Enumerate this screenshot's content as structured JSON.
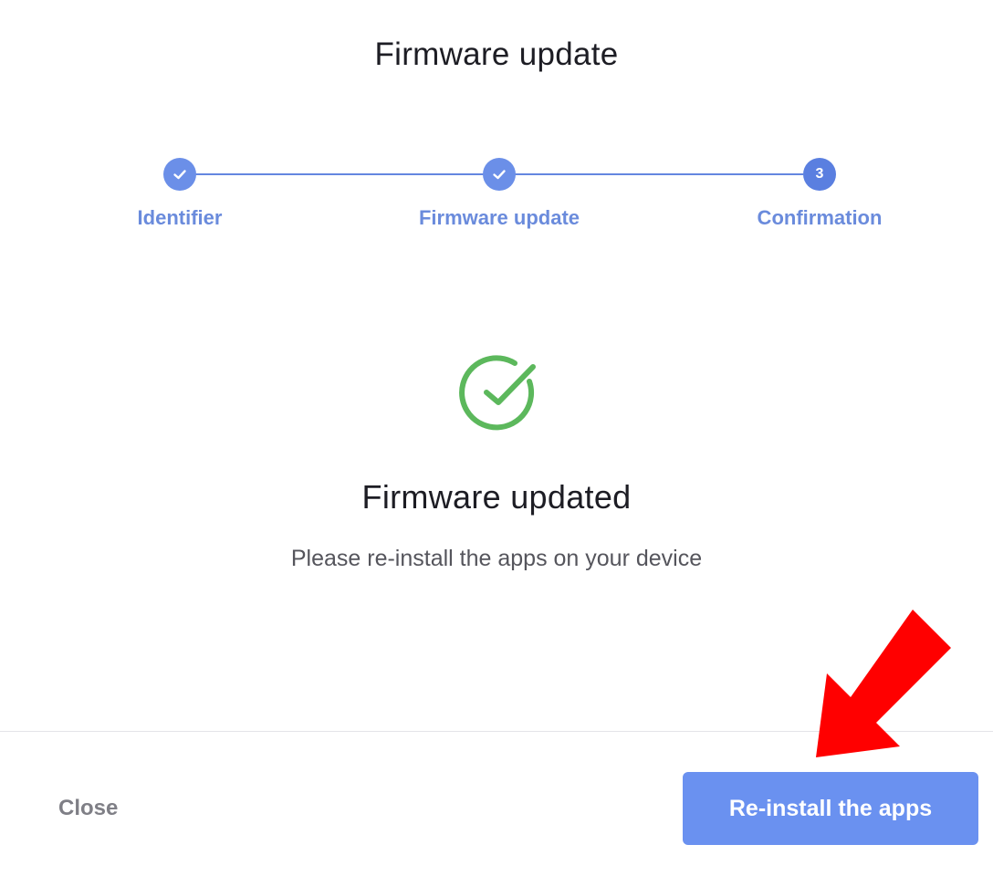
{
  "modal": {
    "title": "Firmware update"
  },
  "stepper": {
    "steps": [
      {
        "label": "Identifier",
        "state": "done",
        "icon": "check-icon"
      },
      {
        "label": "Firmware update",
        "state": "done",
        "icon": "check-icon"
      },
      {
        "label": "Confirmation",
        "state": "active",
        "number": "3"
      }
    ],
    "accent": "#6b8fe8"
  },
  "result": {
    "icon": "success-check-circle-icon",
    "icon_color": "#5cb85c",
    "title": "Firmware updated",
    "description": "Please re-install the apps on your device"
  },
  "footer": {
    "close_label": "Close",
    "primary_label": "Re-install the apps",
    "primary_color": "#6a91f0"
  },
  "annotation": {
    "icon": "red-arrow-pointer",
    "color": "#ff0000"
  }
}
